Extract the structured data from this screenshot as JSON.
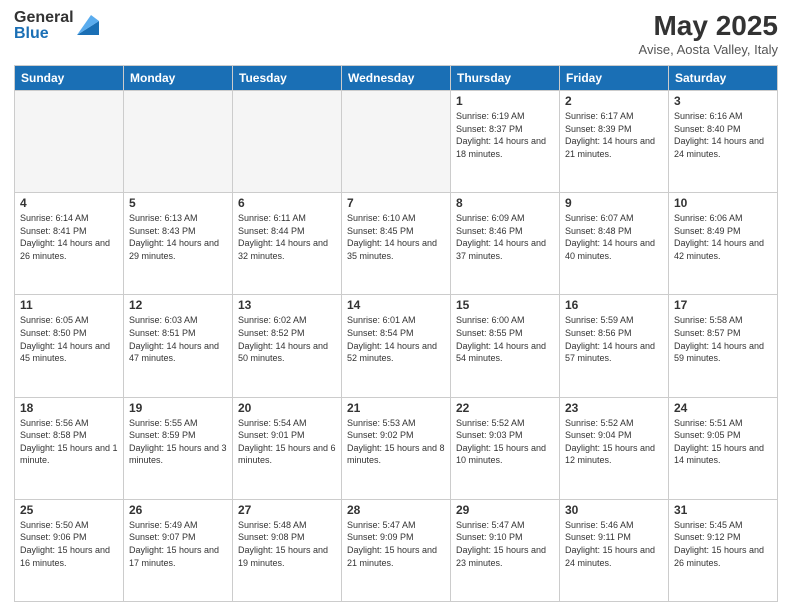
{
  "logo": {
    "general": "General",
    "blue": "Blue"
  },
  "title": "May 2025",
  "subtitle": "Avise, Aosta Valley, Italy",
  "days_of_week": [
    "Sunday",
    "Monday",
    "Tuesday",
    "Wednesday",
    "Thursday",
    "Friday",
    "Saturday"
  ],
  "weeks": [
    [
      {
        "day": "",
        "info": ""
      },
      {
        "day": "",
        "info": ""
      },
      {
        "day": "",
        "info": ""
      },
      {
        "day": "",
        "info": ""
      },
      {
        "day": "1",
        "info": "Sunrise: 6:19 AM\nSunset: 8:37 PM\nDaylight: 14 hours and 18 minutes."
      },
      {
        "day": "2",
        "info": "Sunrise: 6:17 AM\nSunset: 8:39 PM\nDaylight: 14 hours and 21 minutes."
      },
      {
        "day": "3",
        "info": "Sunrise: 6:16 AM\nSunset: 8:40 PM\nDaylight: 14 hours and 24 minutes."
      }
    ],
    [
      {
        "day": "4",
        "info": "Sunrise: 6:14 AM\nSunset: 8:41 PM\nDaylight: 14 hours and 26 minutes."
      },
      {
        "day": "5",
        "info": "Sunrise: 6:13 AM\nSunset: 8:43 PM\nDaylight: 14 hours and 29 minutes."
      },
      {
        "day": "6",
        "info": "Sunrise: 6:11 AM\nSunset: 8:44 PM\nDaylight: 14 hours and 32 minutes."
      },
      {
        "day": "7",
        "info": "Sunrise: 6:10 AM\nSunset: 8:45 PM\nDaylight: 14 hours and 35 minutes."
      },
      {
        "day": "8",
        "info": "Sunrise: 6:09 AM\nSunset: 8:46 PM\nDaylight: 14 hours and 37 minutes."
      },
      {
        "day": "9",
        "info": "Sunrise: 6:07 AM\nSunset: 8:48 PM\nDaylight: 14 hours and 40 minutes."
      },
      {
        "day": "10",
        "info": "Sunrise: 6:06 AM\nSunset: 8:49 PM\nDaylight: 14 hours and 42 minutes."
      }
    ],
    [
      {
        "day": "11",
        "info": "Sunrise: 6:05 AM\nSunset: 8:50 PM\nDaylight: 14 hours and 45 minutes."
      },
      {
        "day": "12",
        "info": "Sunrise: 6:03 AM\nSunset: 8:51 PM\nDaylight: 14 hours and 47 minutes."
      },
      {
        "day": "13",
        "info": "Sunrise: 6:02 AM\nSunset: 8:52 PM\nDaylight: 14 hours and 50 minutes."
      },
      {
        "day": "14",
        "info": "Sunrise: 6:01 AM\nSunset: 8:54 PM\nDaylight: 14 hours and 52 minutes."
      },
      {
        "day": "15",
        "info": "Sunrise: 6:00 AM\nSunset: 8:55 PM\nDaylight: 14 hours and 54 minutes."
      },
      {
        "day": "16",
        "info": "Sunrise: 5:59 AM\nSunset: 8:56 PM\nDaylight: 14 hours and 57 minutes."
      },
      {
        "day": "17",
        "info": "Sunrise: 5:58 AM\nSunset: 8:57 PM\nDaylight: 14 hours and 59 minutes."
      }
    ],
    [
      {
        "day": "18",
        "info": "Sunrise: 5:56 AM\nSunset: 8:58 PM\nDaylight: 15 hours and 1 minute."
      },
      {
        "day": "19",
        "info": "Sunrise: 5:55 AM\nSunset: 8:59 PM\nDaylight: 15 hours and 3 minutes."
      },
      {
        "day": "20",
        "info": "Sunrise: 5:54 AM\nSunset: 9:01 PM\nDaylight: 15 hours and 6 minutes."
      },
      {
        "day": "21",
        "info": "Sunrise: 5:53 AM\nSunset: 9:02 PM\nDaylight: 15 hours and 8 minutes."
      },
      {
        "day": "22",
        "info": "Sunrise: 5:52 AM\nSunset: 9:03 PM\nDaylight: 15 hours and 10 minutes."
      },
      {
        "day": "23",
        "info": "Sunrise: 5:52 AM\nSunset: 9:04 PM\nDaylight: 15 hours and 12 minutes."
      },
      {
        "day": "24",
        "info": "Sunrise: 5:51 AM\nSunset: 9:05 PM\nDaylight: 15 hours and 14 minutes."
      }
    ],
    [
      {
        "day": "25",
        "info": "Sunrise: 5:50 AM\nSunset: 9:06 PM\nDaylight: 15 hours and 16 minutes."
      },
      {
        "day": "26",
        "info": "Sunrise: 5:49 AM\nSunset: 9:07 PM\nDaylight: 15 hours and 17 minutes."
      },
      {
        "day": "27",
        "info": "Sunrise: 5:48 AM\nSunset: 9:08 PM\nDaylight: 15 hours and 19 minutes."
      },
      {
        "day": "28",
        "info": "Sunrise: 5:47 AM\nSunset: 9:09 PM\nDaylight: 15 hours and 21 minutes."
      },
      {
        "day": "29",
        "info": "Sunrise: 5:47 AM\nSunset: 9:10 PM\nDaylight: 15 hours and 23 minutes."
      },
      {
        "day": "30",
        "info": "Sunrise: 5:46 AM\nSunset: 9:11 PM\nDaylight: 15 hours and 24 minutes."
      },
      {
        "day": "31",
        "info": "Sunrise: 5:45 AM\nSunset: 9:12 PM\nDaylight: 15 hours and 26 minutes."
      }
    ]
  ]
}
